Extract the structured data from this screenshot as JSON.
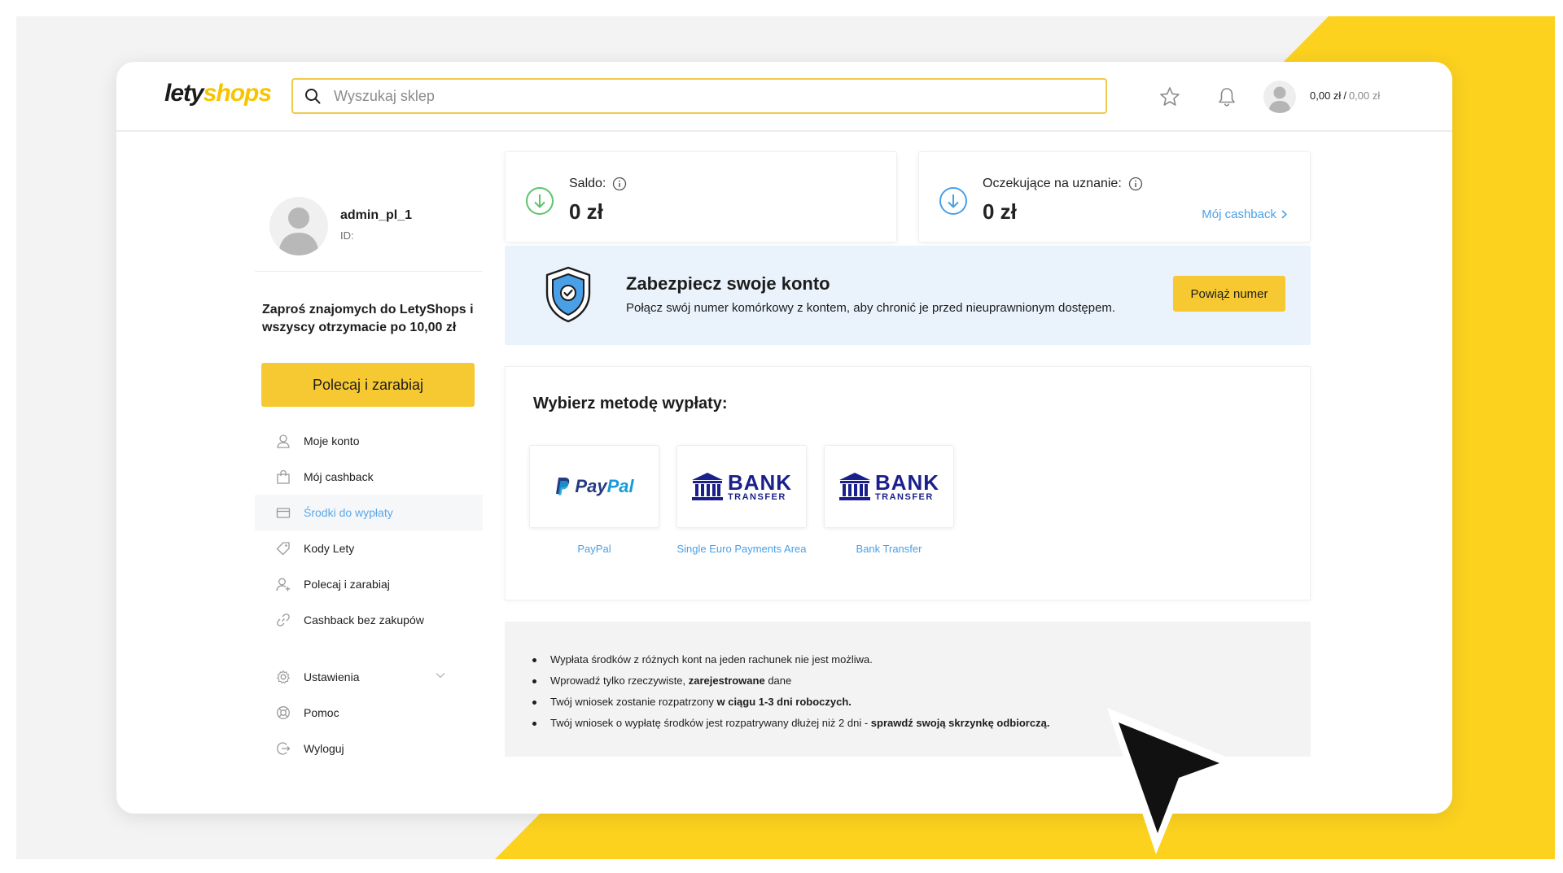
{
  "logo": {
    "part1": "lety",
    "part2": "shops"
  },
  "search": {
    "placeholder": "Wyszukaj sklep",
    "value": ""
  },
  "header": {
    "balance": "0,00 zł",
    "separator": "/",
    "pending": "0,00 zł"
  },
  "profile": {
    "username": "admin_pl_1",
    "id_label": "ID:"
  },
  "invite": {
    "text": "Zaproś znajomych do LetyShops i wszyscy otrzymacie po 10,00 zł",
    "button": "Polecaj i zarabiaj"
  },
  "nav": {
    "items": [
      {
        "label": "Moje konto",
        "icon": "user-icon"
      },
      {
        "label": "Mój cashback",
        "icon": "bag-icon"
      },
      {
        "label": "Środki do wypłaty",
        "icon": "wallet-icon",
        "active": true
      },
      {
        "label": "Kody Lety",
        "icon": "tag-icon"
      },
      {
        "label": "Polecaj i zarabiaj",
        "icon": "add-user-icon"
      },
      {
        "label": "Cashback bez zakupów",
        "icon": "link-icon"
      }
    ],
    "bottom": [
      {
        "label": "Ustawienia",
        "icon": "gear-icon"
      },
      {
        "label": "Pomoc",
        "icon": "lifebuoy-icon"
      },
      {
        "label": "Wyloguj",
        "icon": "logout-icon"
      }
    ]
  },
  "cards": {
    "saldo": {
      "label": "Saldo:",
      "value": "0 zł"
    },
    "pending": {
      "label": "Oczekujące na uznanie:",
      "value": "0 zł",
      "link": "Mój cashback"
    }
  },
  "secure": {
    "title": "Zabezpiecz swoje konto",
    "desc": "Połącz swój numer komórkowy z kontem, aby chronić je przed nieuprawnionym dostępem.",
    "button": "Powiąż numer"
  },
  "methods": {
    "title": "Wybierz metodę wypłaty:",
    "items": [
      {
        "label": "PayPal",
        "logo_text": "PayPal",
        "logo_part1": "Pay",
        "logo_part2": "Pal"
      },
      {
        "label": "Single Euro Payments Area",
        "logo_line1": "BANK",
        "logo_line2": "TRANSFER"
      },
      {
        "label": "Bank Transfer",
        "logo_line1": "BANK",
        "logo_line2": "TRANSFER"
      }
    ]
  },
  "info": {
    "l1": "Wypłata środków z różnych kont na jeden rachunek nie jest możliwa.",
    "l2a": "Wprowadź tylko rzeczywiste, ",
    "l2b": "zarejestrowane",
    "l2c": " dane",
    "l3a": "Twój wniosek zostanie rozpatrzony ",
    "l3b": "w ciągu 1-3 dni roboczych.",
    "l4a": "Twój wniosek o wypłatę środków jest rozpatrywany dłużej niż 2 dni - ",
    "l4b": "sprawdź swoją skrzynkę odbiorczą."
  },
  "colors": {
    "accent": "#f6c932",
    "brand_yellow": "#fcd21f",
    "link": "#4aa0e6",
    "success": "#5cc46b",
    "info": "#4aa0e6"
  }
}
